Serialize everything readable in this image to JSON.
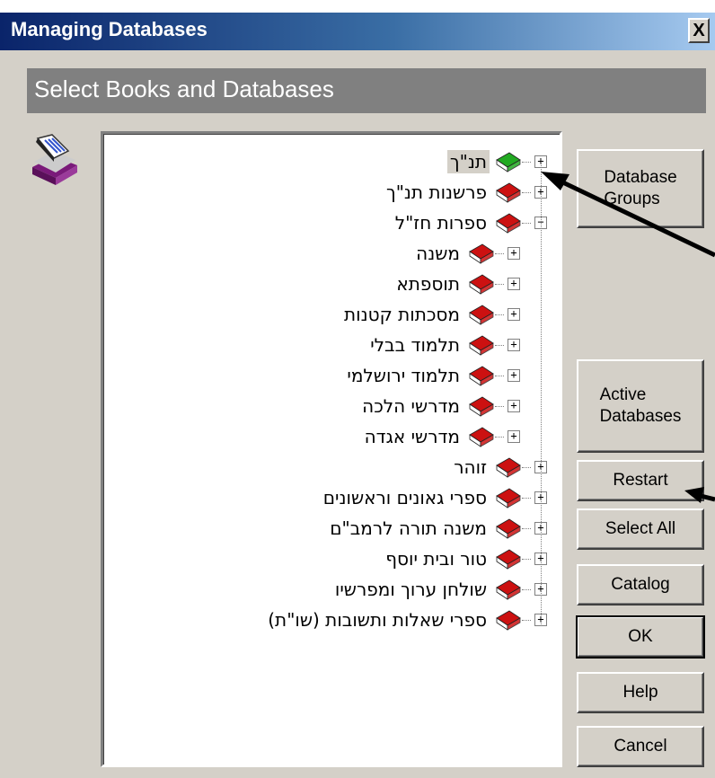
{
  "window": {
    "title": "Managing Databases",
    "close_glyph": "X"
  },
  "header": {
    "text": "Select Books and Databases"
  },
  "app_icon": "books-database-icon",
  "tree": {
    "items": [
      {
        "label": "תנ\"ך",
        "level": 0,
        "expander": "+",
        "book_color": "#22aa22",
        "selected": true
      },
      {
        "label": "פרשנות תנ\"ך",
        "level": 0,
        "expander": "+",
        "book_color": "#cc1111",
        "selected": false
      },
      {
        "label": "ספרות חז\"ל",
        "level": 0,
        "expander": "−",
        "book_color": "#cc1111",
        "selected": false
      },
      {
        "label": "משנה",
        "level": 1,
        "expander": "+",
        "book_color": "#cc1111",
        "selected": false
      },
      {
        "label": "תוספתא",
        "level": 1,
        "expander": "+",
        "book_color": "#cc1111",
        "selected": false
      },
      {
        "label": "מסכתות קטנות",
        "level": 1,
        "expander": "+",
        "book_color": "#cc1111",
        "selected": false
      },
      {
        "label": "תלמוד בבלי",
        "level": 1,
        "expander": "+",
        "book_color": "#cc1111",
        "selected": false
      },
      {
        "label": "תלמוד ירושלמי",
        "level": 1,
        "expander": "+",
        "book_color": "#cc1111",
        "selected": false
      },
      {
        "label": "מדרשי הלכה",
        "level": 1,
        "expander": "+",
        "book_color": "#cc1111",
        "selected": false
      },
      {
        "label": "מדרשי אגדה",
        "level": 1,
        "expander": "+",
        "book_color": "#cc1111",
        "selected": false
      },
      {
        "label": "זוהר",
        "level": 0,
        "expander": "+",
        "book_color": "#cc1111",
        "selected": false
      },
      {
        "label": "ספרי גאונים וראשונים",
        "level": 0,
        "expander": "+",
        "book_color": "#cc1111",
        "selected": false
      },
      {
        "label": "משנה תורה לרמב\"ם",
        "level": 0,
        "expander": "+",
        "book_color": "#cc1111",
        "selected": false
      },
      {
        "label": "טור ובית יוסף",
        "level": 0,
        "expander": "+",
        "book_color": "#cc1111",
        "selected": false
      },
      {
        "label": "שולחן ערוך ומפרשיו",
        "level": 0,
        "expander": "+",
        "book_color": "#cc1111",
        "selected": false
      },
      {
        "label": "ספרי שאלות ותשובות (שו\"ת)",
        "level": 0,
        "expander": "+",
        "book_color": "#cc1111",
        "selected": false
      }
    ]
  },
  "buttons": {
    "database_groups": {
      "line1": "Database",
      "line2": "Groups"
    },
    "active_databases": {
      "line1": "Active",
      "line2": "Databases"
    },
    "restart": "Restart",
    "select_all": "Select All",
    "catalog": "Catalog",
    "ok": "OK",
    "help": "Help",
    "cancel": "Cancel"
  }
}
